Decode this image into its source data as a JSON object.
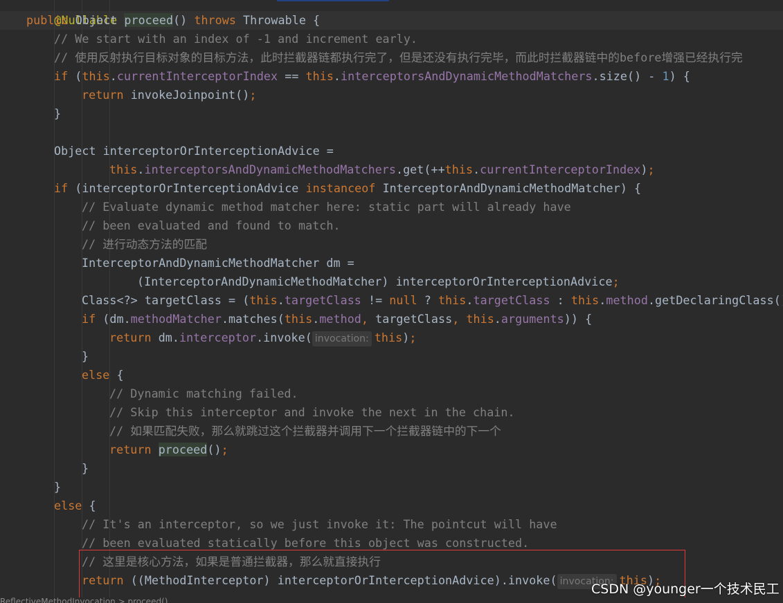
{
  "editor": {
    "line1": {
      "t": "@Nullable"
    },
    "line2": {
      "a": "public ",
      "b": "Object ",
      "c": "proceed",
      "d": "() ",
      "e": "throws ",
      "f": "Throwable {"
    },
    "line3": {
      "t": "// We start with an index of -1 and increment early."
    },
    "line4": {
      "t": "// 使用反射执行目标对象的目标方法，此时拦截器链都执行完了，但是还没有执行完毕，而此时拦截器链中的before增强已经执行完"
    },
    "line5": {
      "a": "if ",
      "b": "(",
      "c": "this",
      "d": ".",
      "e": "currentInterceptorIndex",
      "f": " == ",
      "g": "this",
      "h": ".",
      "i": "interceptorsAndDynamicMethodMatchers",
      "j": ".size() - ",
      "k": "1",
      "l": ") {"
    },
    "line6": {
      "a": "return ",
      "b": "invokeJoinpoint()",
      "c": ";"
    },
    "line7": {
      "t": "}"
    },
    "line9": {
      "t": "Object interceptorOrInterceptionAdvice ="
    },
    "line10": {
      "a": "this",
      "b": ".",
      "c": "interceptorsAndDynamicMethodMatchers",
      "d": ".get(++",
      "e": "this",
      "f": ".",
      "g": "currentInterceptorIndex",
      "h": ")",
      "i": ";"
    },
    "line11": {
      "a": "if ",
      "b": "(interceptorOrInterceptionAdvice ",
      "c": "instanceof ",
      "d": "InterceptorAndDynamicMethodMatcher) {"
    },
    "line12": {
      "t": "// Evaluate dynamic method matcher here: static part will already have"
    },
    "line13": {
      "t": "// been evaluated and found to match."
    },
    "line14": {
      "t": "// 进行动态方法的匹配"
    },
    "line15": {
      "t": "InterceptorAndDynamicMethodMatcher dm ="
    },
    "line16": {
      "a": "(InterceptorAndDynamicMethodMatcher) interceptorOrInterceptionAdvice",
      "b": ";"
    },
    "line17": {
      "a": "Class<?> targetClass = (",
      "b": "this",
      "c": ".",
      "d": "targetClass",
      "e": " != ",
      "f": "null",
      "g": " ? ",
      "h": "this",
      "i": ".",
      "j": "targetClass",
      "k": " : ",
      "l": "this",
      "m": ".",
      "n": "method",
      "o": ".getDeclaringClass())"
    },
    "line18": {
      "a": "if ",
      "b": "(dm.",
      "c": "methodMatcher",
      "d": ".matches(",
      "e": "this",
      "f": ".",
      "g": "method",
      "h": ", ",
      "i": "targetClass",
      "j": ", ",
      "k": "this",
      "l": ".",
      "m": "arguments",
      "n": ")) {"
    },
    "line19": {
      "a": "return ",
      "b": "dm.",
      "c": "interceptor",
      "d": ".invoke(",
      "hint": "invocation:",
      "e": "this",
      "f": ")",
      "g": ";"
    },
    "line20": {
      "t": "}"
    },
    "line21": {
      "a": "else ",
      "b": "{"
    },
    "line22": {
      "t": "// Dynamic matching failed."
    },
    "line23": {
      "t": "// Skip this interceptor and invoke the next in the chain."
    },
    "line24": {
      "t": "// 如果匹配失败，那么就跳过这个拦截器并调用下一个拦截器链中的下一个"
    },
    "line25": {
      "a": "return ",
      "b": "proceed",
      "c": "()",
      "d": ";"
    },
    "line26": {
      "t": "}"
    },
    "line27": {
      "t": "}"
    },
    "line28": {
      "a": "else ",
      "b": "{"
    },
    "line29": {
      "t": "// It's an interceptor, so we just invoke it: The pointcut will have"
    },
    "line30": {
      "t": "// been evaluated statically before this object was constructed."
    },
    "line31": {
      "t": "// 这里是核心方法，如果是普通拦截器，那么就直接执行"
    },
    "line32": {
      "a": "return ",
      "b": "((MethodInterceptor) interceptorOrInterceptionAdvice).invoke(",
      "hint": "invocation:",
      "c": "this",
      "d": ")",
      "e": ";"
    }
  },
  "status": {
    "text": "ReflectiveMethodInvocation > proceed()"
  },
  "watermark": {
    "text": "CSDN @younger一个技术民工"
  },
  "colors": {
    "keyword": "#cc7832",
    "comment": "#808080",
    "field": "#9876aa",
    "number": "#6897bb",
    "annotation": "#bbb529",
    "highlight_box": "#e23a3a"
  }
}
